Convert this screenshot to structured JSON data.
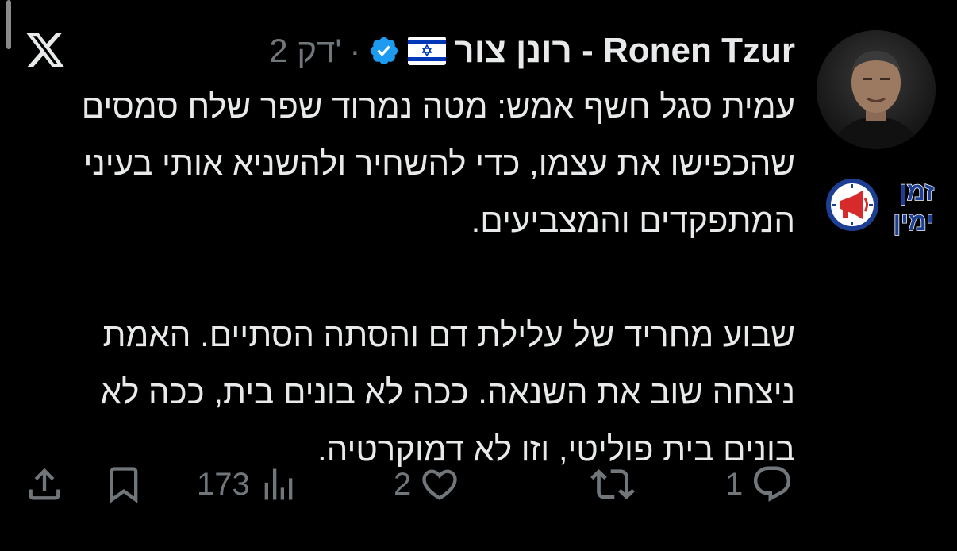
{
  "tweet": {
    "author": {
      "display_name": "רונן צור - Ronen Tzur",
      "verified": true,
      "flag_emoji": "🇮🇱",
      "avatar_icon": "profile-photo",
      "affiliation_badge": {
        "line1": "זמן",
        "line2": "ימין",
        "icon": "megaphone-clock-icon"
      }
    },
    "separator": "·",
    "time": "2 דק'",
    "paragraphs": [
      "עמית סגל חשף אמש: מטה נמרוד שפר שלח סמסים שהכפישו את עצמו, כדי להשחיר ולהשניא אותי בעיני המתפקדים והמצביעים.",
      "שבוע מחריד של עלילת דם והסתה הסתיים. האמת ניצחה שוב את השנאה. ככה לא בונים בית, ככה לא בונים בית פוליטי, וזו לא דמוקרטיה."
    ],
    "actions": {
      "reply": {
        "count": "1",
        "icon": "reply-icon"
      },
      "retweet": {
        "count": "",
        "icon": "retweet-icon"
      },
      "like": {
        "count": "2",
        "icon": "heart-icon"
      },
      "views": {
        "count": "173",
        "icon": "views-icon"
      },
      "bookmark": {
        "count": "",
        "icon": "bookmark-icon"
      },
      "share": {
        "count": "",
        "icon": "share-icon"
      }
    }
  },
  "colors": {
    "background": "#000000",
    "text": "#e7e9ea",
    "muted": "#71767b",
    "verified": "#1d9bf0",
    "badge_blue": "#1c3f94",
    "badge_red": "#d72a2a"
  }
}
